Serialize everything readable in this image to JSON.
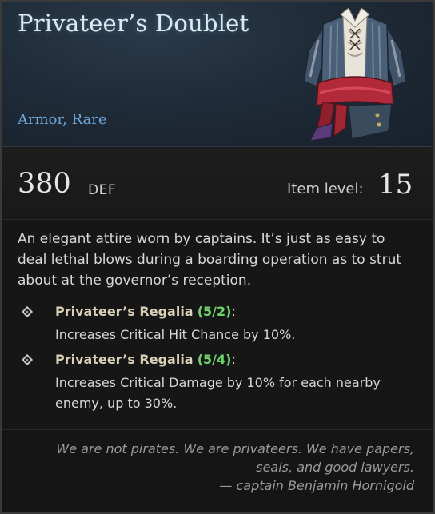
{
  "item": {
    "name": "Privateer’s Doublet",
    "type": "Armor, Rare",
    "image_icon": "doublet-armor-icon"
  },
  "stats": {
    "def_value": "380",
    "def_label": "DEF",
    "item_level_label": "Item level:",
    "item_level_value": "15"
  },
  "description": "An elegant attire worn by captains. It’s just as easy to deal lethal blows during a boarding operation as to strut about at the governor’s reception.",
  "set_bonuses": [
    {
      "name": "Privateer’s Regalia",
      "count": "(5/2)",
      "colon": ":",
      "effect": "Increases Critical Hit Chance by 10%."
    },
    {
      "name": "Privateer’s Regalia",
      "count": "(5/4)",
      "colon": ":",
      "effect": "Increases Critical Damage by 10% for each nearby enemy, up to 30%."
    }
  ],
  "quote": {
    "line1": "We are not pirates. We are privateers. We have papers,",
    "line2": "seals, and good lawyers.",
    "line3": "— captain Benjamin Hornigold"
  },
  "colors": {
    "title": "#dcebf3",
    "rarity": "#6fa6d8",
    "set_count": "#6fd36b",
    "quote": "#9a9a9a"
  }
}
